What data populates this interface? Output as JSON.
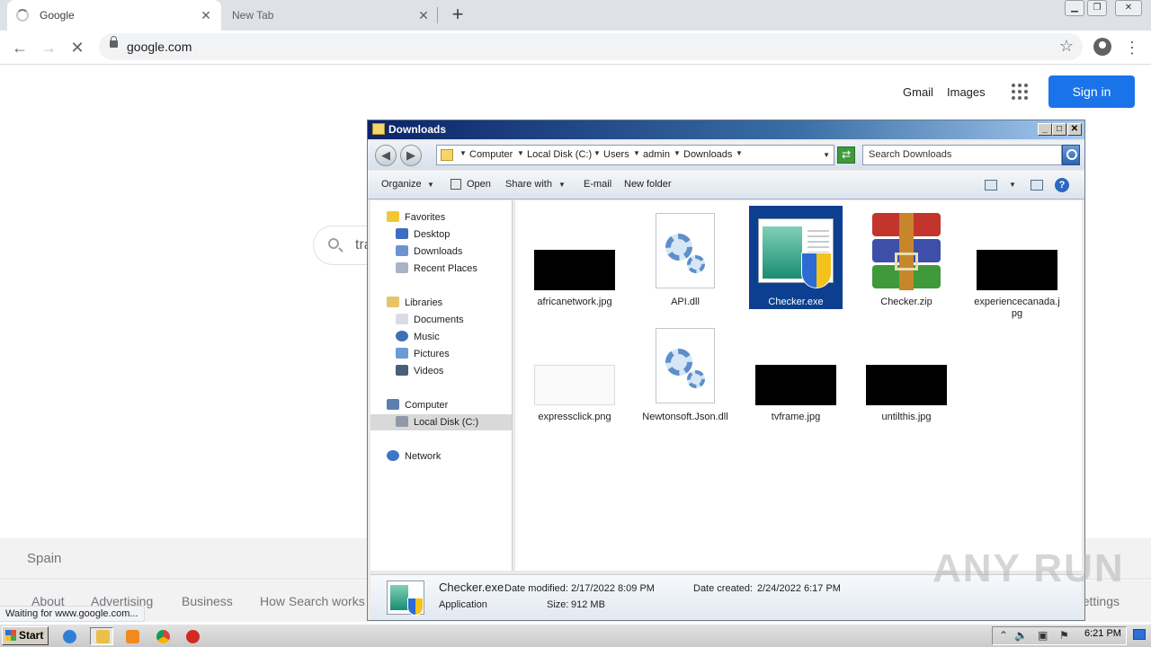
{
  "browser": {
    "tabs": [
      {
        "title": "Google",
        "loading": true,
        "active": true
      },
      {
        "title": "New Tab",
        "loading": false,
        "active": false
      }
    ],
    "url": "google.com"
  },
  "google": {
    "top_links": [
      "Gmail",
      "Images"
    ],
    "sign_in": "Sign in",
    "search_query_partial": "tra",
    "footer_country": "Spain",
    "footer_links": [
      "About",
      "Advertising",
      "Business",
      "How Search works"
    ],
    "footer_settings": "Settings",
    "status_text": "Waiting for www.google.com..."
  },
  "explorer": {
    "title": "Downloads",
    "breadcrumbs": [
      "Computer",
      "Local Disk (C:)",
      "Users",
      "admin",
      "Downloads"
    ],
    "search_placeholder": "Search Downloads",
    "commands": [
      "Organize",
      "Open",
      "Share with",
      "E-mail",
      "New folder"
    ],
    "nav": {
      "favorites": "Favorites",
      "favorites_items": [
        "Desktop",
        "Downloads",
        "Recent Places"
      ],
      "libraries": "Libraries",
      "libraries_items": [
        "Documents",
        "Music",
        "Pictures",
        "Videos"
      ],
      "computer": "Computer",
      "computer_items": [
        "Local Disk (C:)"
      ],
      "network": "Network"
    },
    "files": [
      {
        "name": "africanetwork.jpg",
        "kind": "image-dark"
      },
      {
        "name": "API.dll",
        "kind": "dll"
      },
      {
        "name": "Checker.exe",
        "kind": "exe",
        "selected": true
      },
      {
        "name": "Checker.zip",
        "kind": "archive"
      },
      {
        "name": "experiencecanada.jpg",
        "kind": "image-dark"
      },
      {
        "name": "expressclick.png",
        "kind": "image-light"
      },
      {
        "name": "Newtonsoft.Json.dll",
        "kind": "dll"
      },
      {
        "name": "tvframe.jpg",
        "kind": "image-dark"
      },
      {
        "name": "untilthis.jpg",
        "kind": "image-dark"
      }
    ],
    "details": {
      "name": "Checker.exe",
      "type": "Application",
      "date_modified_label": "Date modified:",
      "date_modified": "2/17/2022 8:09 PM",
      "size_label": "Size:",
      "size": "912 MB",
      "date_created_label": "Date created:",
      "date_created": "2/24/2022 6:17 PM"
    }
  },
  "taskbar": {
    "start_label": "Start",
    "clock": "6:21 PM"
  },
  "watermark": "ANY RUN",
  "colors": {
    "signin_blue": "#1a73e8",
    "selection_blue": "#0c3f8f",
    "titlebar_start": "#0a246a"
  }
}
